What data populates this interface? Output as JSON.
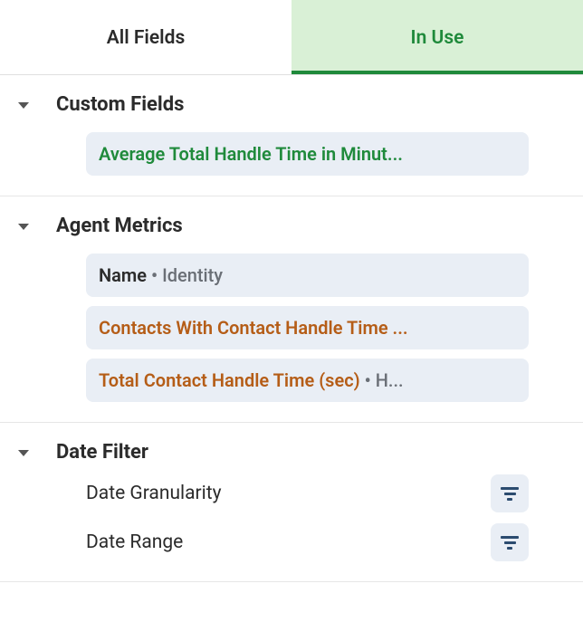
{
  "tabs": {
    "all_fields": "All Fields",
    "in_use": "In Use"
  },
  "sections": {
    "custom_fields": {
      "title": "Custom Fields",
      "items": [
        {
          "label": "Average Total Handle Time in Minut..."
        }
      ]
    },
    "agent_metrics": {
      "title": "Agent Metrics",
      "items": [
        {
          "primary": "Name",
          "secondary": "Identity",
          "primary_style": "default"
        },
        {
          "primary": "Contacts With Contact Handle Time ...",
          "secondary": "",
          "primary_style": "orange"
        },
        {
          "primary": "Total Contact Handle Time (sec)",
          "secondary": "H...",
          "primary_style": "orange"
        }
      ]
    },
    "date_filter": {
      "title": "Date Filter",
      "items": [
        {
          "label": "Date Granularity"
        },
        {
          "label": "Date Range"
        }
      ]
    }
  }
}
